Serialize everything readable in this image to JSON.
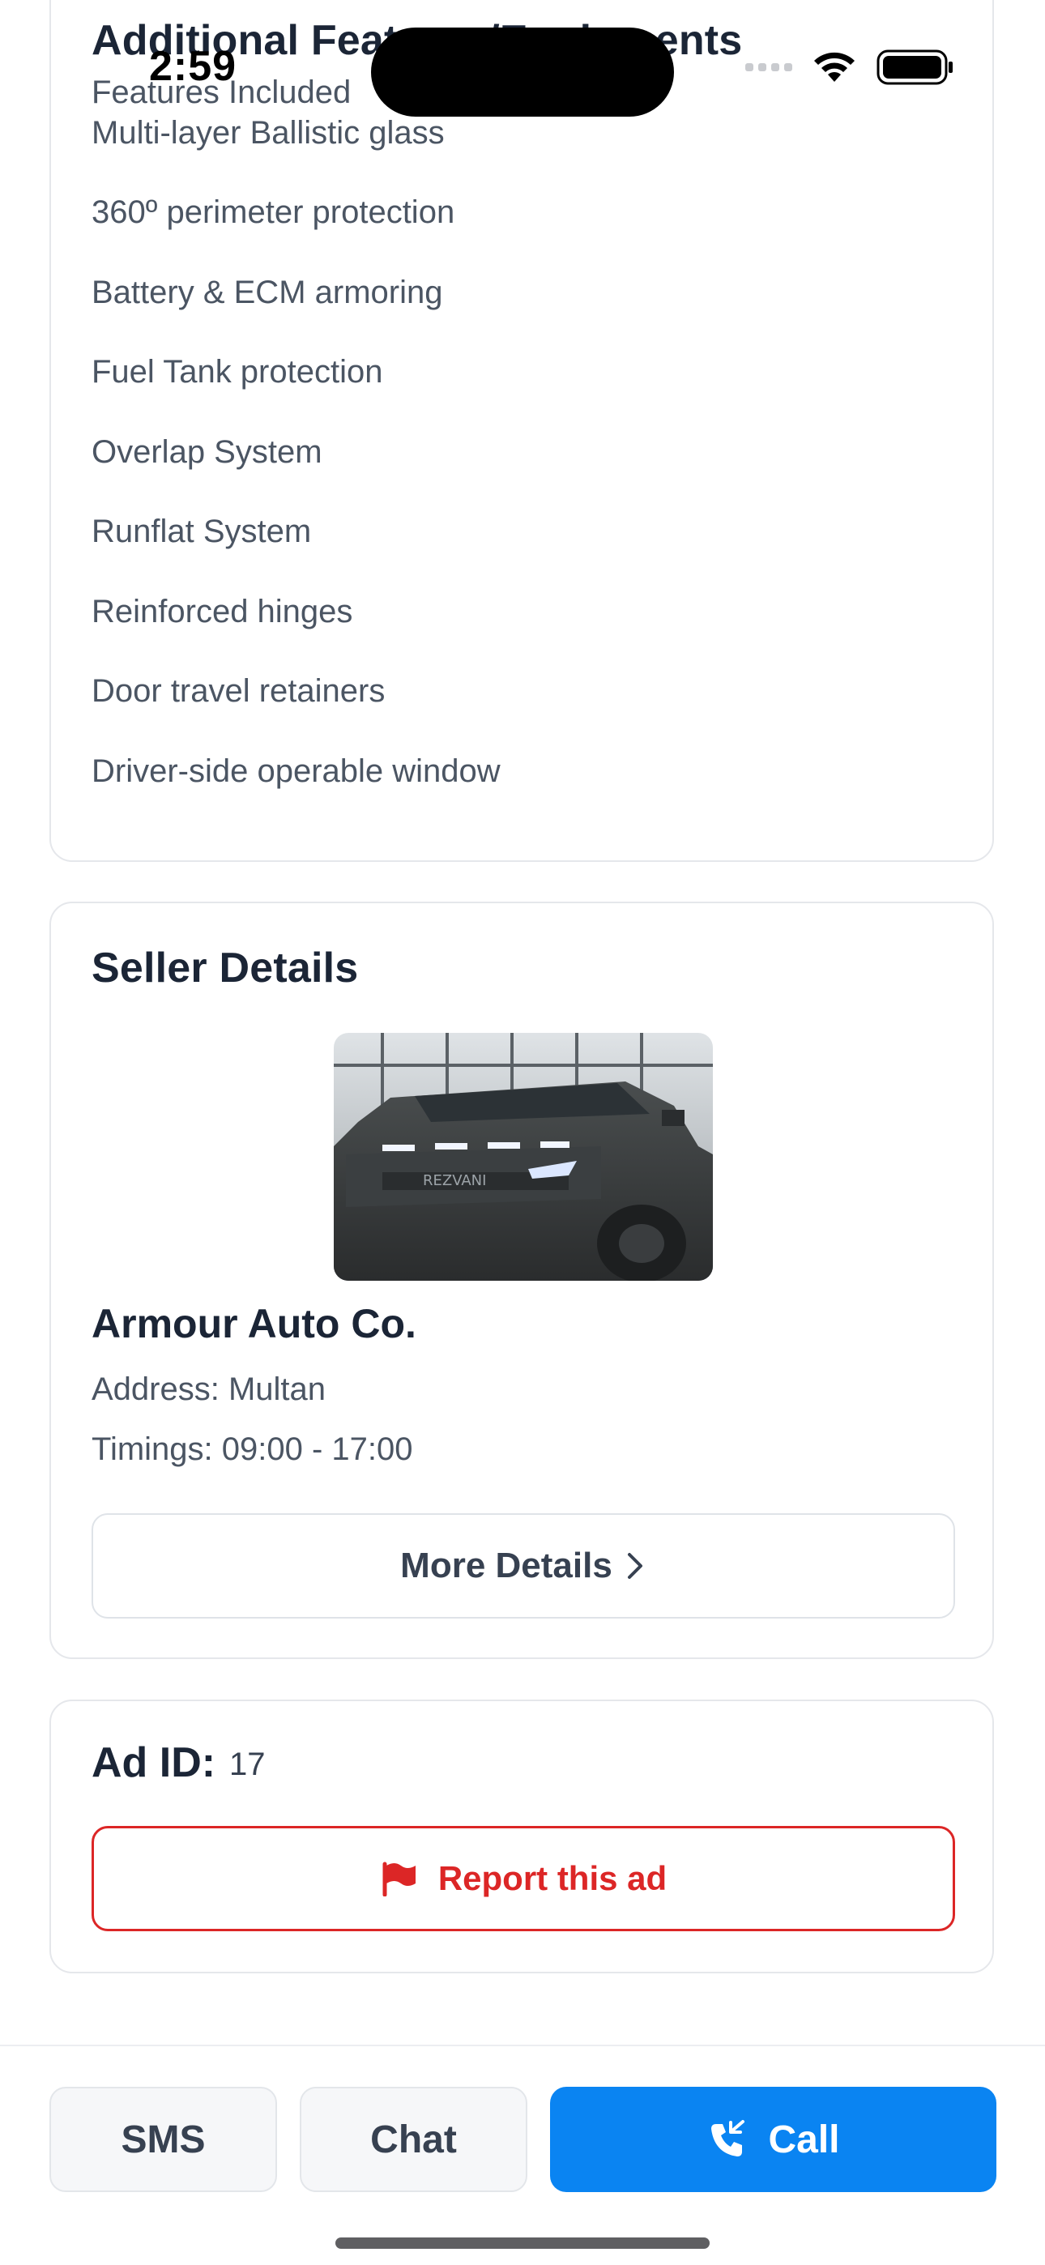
{
  "status_bar": {
    "time": "2:59"
  },
  "features": {
    "title": "Additional Features/Equipments",
    "subtitle": "Features Included",
    "items": [
      "Multi-layer Ballistic glass",
      "360º perimeter protection",
      "Battery & ECM armoring",
      "Fuel Tank protection",
      "Overlap System",
      "Runflat System",
      "Reinforced hinges",
      "Door travel retainers",
      "Driver-side operable window"
    ]
  },
  "seller": {
    "title": "Seller Details",
    "image_icon": "armored-vehicle-photo",
    "name": "Armour Auto Co.",
    "address": "Address: Multan",
    "timings": "Timings: 09:00 - 17:00",
    "more_details_label": "More Details"
  },
  "ad": {
    "id_label": "Ad ID:",
    "id_value": "17",
    "report_label": "Report this ad",
    "report_color": "#dc2626"
  },
  "bottom_bar": {
    "sms_label": "SMS",
    "chat_label": "Chat",
    "call_label": "Call",
    "call_color": "#0a84f2"
  }
}
